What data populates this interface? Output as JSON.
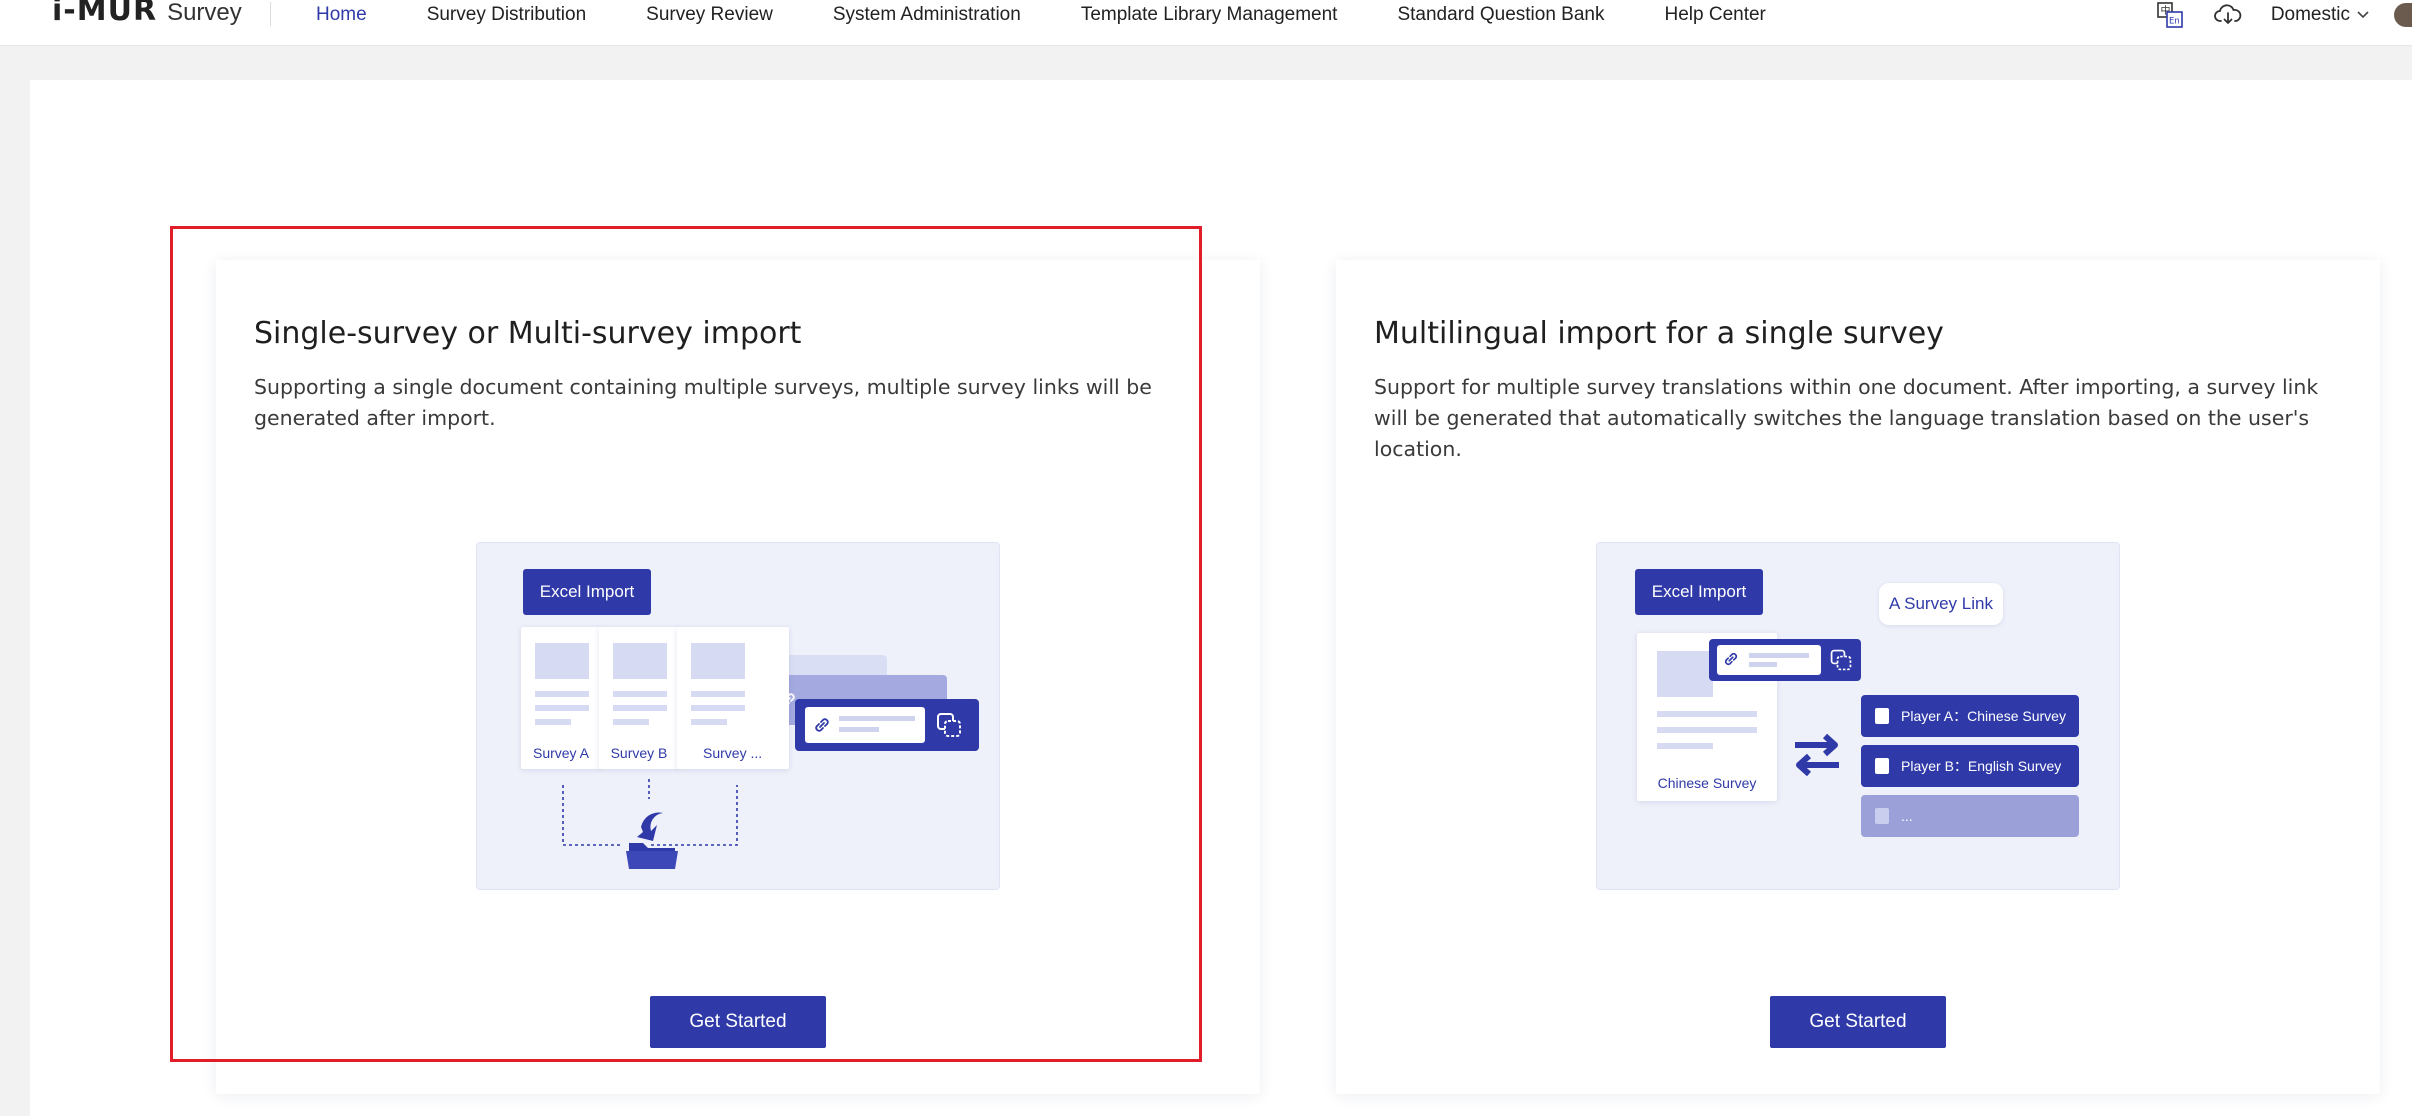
{
  "header": {
    "logo": {
      "mark": "i-MUR",
      "product": "Survey"
    },
    "nav": [
      {
        "label": "Home",
        "active": true
      },
      {
        "label": "Survey Distribution",
        "active": false
      },
      {
        "label": "Survey Review",
        "active": false
      },
      {
        "label": "System Administration",
        "active": false
      },
      {
        "label": "Template Library Management",
        "active": false
      },
      {
        "label": "Standard Question Bank",
        "active": false
      },
      {
        "label": "Help Center",
        "active": false
      }
    ],
    "tools": {
      "language_icon": "translate-icon",
      "download_icon": "cloud-download-icon",
      "region": "Domestic"
    }
  },
  "cards": [
    {
      "title": "Single-survey or Multi-survey import",
      "description": "Supporting a single document containing multiple surveys, multiple survey links will be generated after import.",
      "illustration": {
        "tag": "Excel Import",
        "surveys": [
          "Survey A",
          "Survey B",
          "Survey ..."
        ]
      },
      "button": "Get Started",
      "highlighted": true
    },
    {
      "title": "Multilingual import for a single survey",
      "description": "Support for multiple survey translations within one document. After importing, a survey link will be generated that automatically switches the language translation based on the user's location.",
      "illustration": {
        "tag": "Excel Import",
        "bubble": "A Survey Link",
        "document": "Chinese Survey",
        "players": [
          "Player A：Chinese Survey",
          "Player B：English Survey",
          "..."
        ]
      },
      "button": "Get Started",
      "highlighted": false
    }
  ],
  "colors": {
    "brand": "#2f3aa8",
    "highlight": "#e01e2a",
    "illustration_bg": "#eef0fa"
  }
}
